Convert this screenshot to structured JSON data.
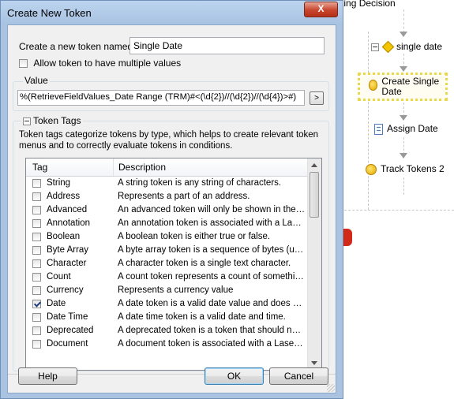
{
  "workflow": {
    "nodes": [
      {
        "id": "routing",
        "label": "Routing Decision"
      },
      {
        "id": "single_date",
        "label": "single date"
      },
      {
        "id": "create_single_date",
        "label": "Create Single Date"
      },
      {
        "id": "assign_date",
        "label": "Assign Date"
      },
      {
        "id": "track_tokens",
        "label": "Track Tokens 2"
      }
    ]
  },
  "dialog": {
    "title": "Create New Token",
    "close_label": "X",
    "name_label": "Create a new token named:",
    "name_value": "Single Date",
    "multi_label": "Allow token to have multiple values",
    "value_label": "Value",
    "value_text": "%(RetrieveFieldValues_Date Range (TRM)#<(\\d{2})//(\\d{2})//(\\d{4})>#)",
    "value_button": ">",
    "tags_label": "Token Tags",
    "tags_desc": "Token tags categorize tokens by type, which helps to create relevant token menus and to correctly evaluate tokens in conditions.",
    "table": {
      "col_tag": "Tag",
      "col_desc": "Description",
      "rows": [
        {
          "tag": "String",
          "desc": "A string token is any string of characters.",
          "checked": false
        },
        {
          "tag": "Address",
          "desc": "Represents a part of an address.",
          "checked": false
        },
        {
          "tag": "Advanced",
          "desc": "An advanced token will only be shown in the t...",
          "checked": false
        },
        {
          "tag": "Annotation",
          "desc": "An annotation token is associated with a Laser...",
          "checked": false
        },
        {
          "tag": "Boolean",
          "desc": "A boolean token is either true or false.",
          "checked": false
        },
        {
          "tag": "Byte Array",
          "desc": "A byte array token is a sequence of bytes (unsi...",
          "checked": false
        },
        {
          "tag": "Character",
          "desc": "A character token is a single text character.",
          "checked": false
        },
        {
          "tag": "Count",
          "desc": "A count token represents a count of something...",
          "checked": false
        },
        {
          "tag": "Currency",
          "desc": "Represents a currency value",
          "checked": false
        },
        {
          "tag": "Date",
          "desc": "A date token is a valid date value and does no...",
          "checked": true
        },
        {
          "tag": "Date Time",
          "desc": "A date time token is a valid date and time.",
          "checked": false
        },
        {
          "tag": "Deprecated",
          "desc": "A deprecated token is a token that should no l...",
          "checked": false
        },
        {
          "tag": "Document",
          "desc": "A document token is associated with a Laserfic...",
          "checked": false
        }
      ]
    },
    "help_label": "Help",
    "ok_label": "OK",
    "cancel_label": "Cancel"
  }
}
